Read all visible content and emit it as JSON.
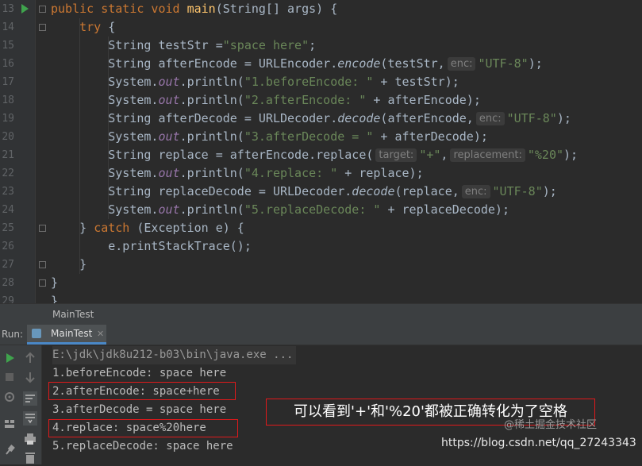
{
  "editor": {
    "lines": [
      {
        "n": "13",
        "tokens": [
          [
            "kw",
            "public static void "
          ],
          [
            "fn",
            "main"
          ],
          [
            "",
            "(String[] args) {"
          ]
        ]
      },
      {
        "n": "14",
        "tokens": [
          [
            "kw",
            "    try "
          ],
          [
            "",
            "{"
          ]
        ]
      },
      {
        "n": "15",
        "tokens": [
          [
            "",
            "        String testStr ="
          ],
          [
            "str",
            "\"space here\""
          ],
          [
            "",
            ";"
          ]
        ]
      },
      {
        "n": "16",
        "tokens": [
          [
            "",
            "        String afterEncode = URLEncoder."
          ],
          [
            "it",
            "encode"
          ],
          [
            "",
            "(testStr,"
          ],
          [
            "hint",
            "enc:"
          ],
          [
            "str",
            "\"UTF-8\""
          ],
          [
            "",
            ");"
          ]
        ]
      },
      {
        "n": "17",
        "tokens": [
          [
            "",
            "        System."
          ],
          [
            "fld",
            "out"
          ],
          [
            "",
            ".println("
          ],
          [
            "str",
            "\"1.beforeEncode: \""
          ],
          [
            "",
            " + testStr);"
          ]
        ]
      },
      {
        "n": "18",
        "tokens": [
          [
            "",
            "        System."
          ],
          [
            "fld",
            "out"
          ],
          [
            "",
            ".println("
          ],
          [
            "str",
            "\"2.afterEncode: \""
          ],
          [
            "",
            " + afterEncode);"
          ]
        ]
      },
      {
        "n": "19",
        "tokens": [
          [
            "",
            "        String afterDecode = URLDecoder."
          ],
          [
            "it",
            "decode"
          ],
          [
            "",
            "(afterEncode,"
          ],
          [
            "hint",
            "enc:"
          ],
          [
            "str",
            "\"UTF-8\""
          ],
          [
            "",
            ");"
          ]
        ]
      },
      {
        "n": "20",
        "tokens": [
          [
            "",
            "        System."
          ],
          [
            "fld",
            "out"
          ],
          [
            "",
            ".println("
          ],
          [
            "str",
            "\"3.afterDecode = \""
          ],
          [
            "",
            " + afterDecode);"
          ]
        ]
      },
      {
        "n": "21",
        "tokens": [
          [
            "",
            "        String replace = afterEncode.replace("
          ],
          [
            "hint",
            "target:"
          ],
          [
            "str",
            "\"+\""
          ],
          [
            "",
            ","
          ],
          [
            "hint",
            "replacement:"
          ],
          [
            "str",
            "\"%20\""
          ],
          [
            "",
            ");"
          ]
        ]
      },
      {
        "n": "22",
        "tokens": [
          [
            "",
            "        System."
          ],
          [
            "fld",
            "out"
          ],
          [
            "",
            ".println("
          ],
          [
            "str",
            "\"4.replace: \""
          ],
          [
            "",
            " + replace);"
          ]
        ]
      },
      {
        "n": "23",
        "tokens": [
          [
            "",
            "        String replaceDecode = URLDecoder."
          ],
          [
            "it",
            "decode"
          ],
          [
            "",
            "(replace,"
          ],
          [
            "hint",
            "enc:"
          ],
          [
            "str",
            "\"UTF-8\""
          ],
          [
            "",
            ");"
          ]
        ]
      },
      {
        "n": "24",
        "tokens": [
          [
            "",
            "        System."
          ],
          [
            "fld",
            "out"
          ],
          [
            "",
            ".println("
          ],
          [
            "str",
            "\"5.replaceDecode: \""
          ],
          [
            "",
            " + replaceDecode);"
          ]
        ]
      },
      {
        "n": "25",
        "tokens": [
          [
            "",
            "    } "
          ],
          [
            "kw",
            "catch "
          ],
          [
            "",
            "(Exception e) {"
          ]
        ]
      },
      {
        "n": "26",
        "tokens": [
          [
            "",
            "        e.printStackTrace();"
          ]
        ]
      },
      {
        "n": "27",
        "tokens": [
          [
            "",
            "    }"
          ]
        ]
      },
      {
        "n": "28",
        "tokens": [
          [
            "",
            "}"
          ]
        ]
      },
      {
        "n": "29",
        "tokens": [
          [
            "",
            "}"
          ]
        ]
      }
    ]
  },
  "breadcrumb": {
    "label": "MainTest"
  },
  "run_panel": {
    "label": "Run:",
    "tab_label": "MainTest",
    "tab_close": "✕",
    "console_lines": [
      "E:\\jdk\\jdk8u212-b03\\bin\\java.exe ...",
      "1.beforeEncode: space here",
      "2.afterEncode: space+here",
      "3.afterDecode = space here",
      "4.replace: space%20here",
      "5.replaceDecode: space here"
    ]
  },
  "annotation": {
    "text": "可以看到'+'和'%20'都被正确转化为了空格"
  },
  "watermark": {
    "text": "https://blog.csdn.net/qq_27243343",
    "secondary": "@稀土掘金技术社区"
  },
  "colors": {
    "run_green": "#3fa34d",
    "highlight_red": "#e0191b",
    "tab_accent": "#4a88c7"
  }
}
